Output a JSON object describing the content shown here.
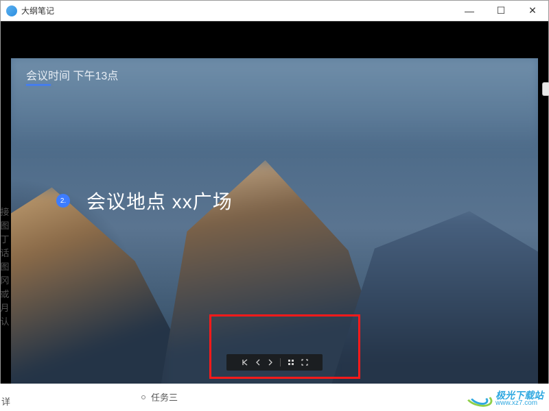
{
  "titlebar": {
    "title": "大纲笔记"
  },
  "window_controls": {
    "min": "—",
    "max": "☐",
    "close": "✕"
  },
  "slide": {
    "header": "会议时间 下午13点",
    "bullet_number": "2.",
    "bullet_text": "会议地点 xx广场"
  },
  "toolbar": {
    "first": "first-icon",
    "prev": "prev-icon",
    "next": "next-icon",
    "page": "page-indicator",
    "fullscreen": "fullscreen-icon"
  },
  "left_sidebar_chars": "接\n图\n丁\n话\n图\n冈\n或\n月\n认",
  "bottom_item": "任务三",
  "below_page_label": "详",
  "watermark": {
    "cn": "极光下载站",
    "en": "www.xz7.com"
  }
}
